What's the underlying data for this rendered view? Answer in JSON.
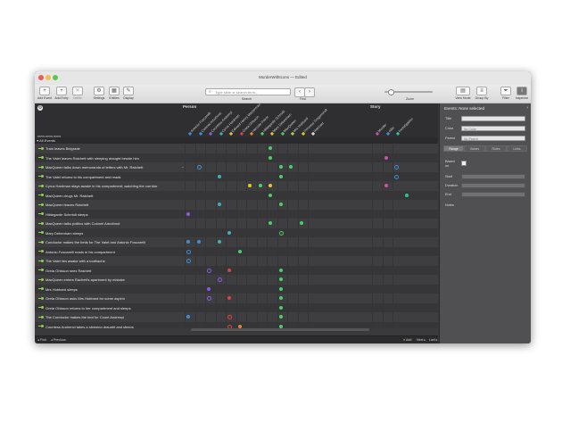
{
  "window": {
    "title": "MurderWithIcons — Edited",
    "traffic": [
      "#ee5c56",
      "#f5bd4f",
      "#5fc454"
    ]
  },
  "toolbar": {
    "add_event": "Add Event",
    "add_entry": "Add Entry",
    "delete": "Delete",
    "settings": "Settings",
    "entities": "Entities",
    "display": "Display",
    "search_placeholder": "Type slide or search term...",
    "search_label": "Search",
    "find_label": "Find",
    "zoom_label": "Zoom",
    "view_mode": "View Mode",
    "group_by": "Group By",
    "filter": "Filter",
    "inspector": "Inspector"
  },
  "columns": {
    "person_header": "Person",
    "story_header": "Story",
    "persons": [
      {
        "name": "Antonio Foscarelli",
        "color": "#3a8fd9"
      },
      {
        "name": "Colonel Arbuthnot",
        "color": "#3a8fd9"
      },
      {
        "name": "Countess Andrenyi",
        "color": "#8e5be0"
      },
      {
        "name": "Cyrus Hardman",
        "color": "#3fb0b7"
      },
      {
        "name": "Edward Henry Masterman",
        "color": "#e8c22e"
      },
      {
        "name": "Greta Ohlsson",
        "color": "#e04040"
      },
      {
        "name": "Hercule Poirot",
        "color": "#e8803a"
      },
      {
        "name": "Hildegarde Schmidt",
        "color": "#4ad068"
      },
      {
        "name": "Mary Debenham",
        "color": "#e8c22e"
      },
      {
        "name": "MacQueen",
        "color": "#4ad068"
      },
      {
        "name": "Mrs Hubbard",
        "color": "#a8d048"
      },
      {
        "name": "Princess Dragomiroff",
        "color": "#e8c22e"
      },
      {
        "name": "Ratchett",
        "color": "#d9d9d9"
      }
    ],
    "stories": [
      {
        "name": "Murder",
        "color": "#c94fb0"
      },
      {
        "name": "Alibi",
        "color": "#3a8fd9"
      },
      {
        "name": "Investigation",
        "color": "#2fc0a0"
      }
    ]
  },
  "section": "All Events",
  "events": [
    {
      "label": "Train leaves Belgrade",
      "dots": [
        {
          "c": 8,
          "color": "#4ad068",
          "h": false
        }
      ]
    },
    {
      "label": "The Valet leaves Ratchett with sleeping draught beside him",
      "dots": [
        {
          "c": 8,
          "color": "#4ad068",
          "h": false
        },
        {
          "c": 14,
          "color": "#c94fb0",
          "h": false
        }
      ]
    },
    {
      "label": "MacQueen talks down memoranda of letters with Mr. Ratchett",
      "dots": [
        {
          "c": 1,
          "color": "#3a8fd9",
          "h": true
        },
        {
          "c": 9,
          "color": "#4ad068",
          "h": false
        },
        {
          "c": 10,
          "color": "#4ad068",
          "h": false
        },
        {
          "c": 15,
          "color": "#3a8fd9",
          "h": true
        }
      ],
      "chev": true
    },
    {
      "label": "The Valet returns to his compartment and reads",
      "dots": [
        {
          "c": 3,
          "color": "#3fb0b7",
          "h": false
        },
        {
          "c": 9,
          "color": "#4ad068",
          "h": false
        },
        {
          "c": 15,
          "color": "#3a8fd9",
          "h": true
        }
      ]
    },
    {
      "label": "Cyrus Hardman stays awake in his compartment, watching the corridor",
      "dots": [
        {
          "c": 6,
          "color": "#e8c22e",
          "h": false
        },
        {
          "c": 7,
          "color": "#4ad068",
          "h": false
        },
        {
          "c": 8,
          "color": "#e8c22e",
          "h": false
        },
        {
          "c": 14,
          "color": "#c94fb0",
          "h": false
        }
      ]
    },
    {
      "label": "MacQueen drugs Mr. Ratchett",
      "dots": [
        {
          "c": 8,
          "color": "#4ad068",
          "h": false
        },
        {
          "c": 16,
          "color": "#2fc0a0",
          "h": false
        }
      ]
    },
    {
      "label": "MacQueen leaves Ratchett",
      "dots": [
        {
          "c": 3,
          "color": "#3fb0b7",
          "h": false
        },
        {
          "c": 9,
          "color": "#4ad068",
          "h": false
        }
      ]
    },
    {
      "label": "Hildegarde Schmidt sleeps",
      "dots": [
        {
          "c": 0,
          "color": "#8e5be0",
          "h": false
        }
      ]
    },
    {
      "label": "MacQueen talks politics with Colonel Arbuthnot",
      "dots": [
        {
          "c": 8,
          "color": "#4ad068",
          "h": false
        },
        {
          "c": 11,
          "color": "#4ad068",
          "h": false
        }
      ]
    },
    {
      "label": "Mary Debenham sleeps",
      "dots": [
        {
          "c": 4,
          "color": "#3fb0b7",
          "h": false
        },
        {
          "c": 9,
          "color": "#4ad068",
          "h": true
        }
      ]
    },
    {
      "label": "Conductor makes the beds for The Valet and Antonio Foscarelli",
      "dots": [
        {
          "c": 0,
          "color": "#3a8fd9",
          "h": false
        },
        {
          "c": 1,
          "color": "#3a8fd9",
          "h": false
        },
        {
          "c": 3,
          "color": "#3fb0b7",
          "h": false
        }
      ]
    },
    {
      "label": "Antonio Foscarelli reads in his compartment",
      "dots": [
        {
          "c": 0,
          "color": "#3a8fd9",
          "h": true
        },
        {
          "c": 5,
          "color": "#4ad068",
          "h": false
        }
      ]
    },
    {
      "label": "The Valet lies awake with a toothache",
      "dots": [
        {
          "c": 0,
          "color": "#3a8fd9",
          "h": true
        }
      ]
    },
    {
      "label": "Greta Ohlsson sees Ratchett",
      "dots": [
        {
          "c": 2,
          "color": "#8e5be0",
          "h": true
        },
        {
          "c": 4,
          "color": "#e04040",
          "h": false
        },
        {
          "c": 9,
          "color": "#4ad068",
          "h": false
        }
      ]
    },
    {
      "label": "MacQueen enters Rachett's apartment by mistake",
      "dots": [
        {
          "c": 3,
          "color": "#8e5be0",
          "h": true
        },
        {
          "c": 9,
          "color": "#4ad068",
          "h": false
        }
      ]
    },
    {
      "label": "Mrs Hubbard sleeps",
      "dots": [
        {
          "c": 2,
          "color": "#8e5be0",
          "h": false
        },
        {
          "c": 9,
          "color": "#4ad068",
          "h": false
        }
      ]
    },
    {
      "label": "Greta Ohlsson asks Mrs Hubbard for some aspirin",
      "dots": [
        {
          "c": 2,
          "color": "#8e5be0",
          "h": true
        },
        {
          "c": 4,
          "color": "#e04040",
          "h": false
        },
        {
          "c": 9,
          "color": "#4ad068",
          "h": false
        }
      ]
    },
    {
      "label": "Greta Ohlsson returns to her compartment and sleeps",
      "dots": [
        {
          "c": 9,
          "color": "#4ad068",
          "h": false
        }
      ]
    },
    {
      "label": "The Conductor makes the bed for Count Andrenyi",
      "dots": [
        {
          "c": 0,
          "color": "#3a8fd9",
          "h": false
        },
        {
          "c": 4,
          "color": "#e04040",
          "h": true
        },
        {
          "c": 9,
          "color": "#4ad068",
          "h": false
        }
      ]
    },
    {
      "label": "Countess Andrenyi takes a sleeping draught and sleeps",
      "dots": [
        {
          "c": 4,
          "color": "#e04040",
          "h": true
        },
        {
          "c": 5,
          "color": "#e8803a",
          "h": false
        },
        {
          "c": 9,
          "color": "#4ad068",
          "h": false
        }
      ]
    },
    {
      "label": "Count Andrenyi sleeps",
      "dots": [
        {
          "c": 4,
          "color": "#e04040",
          "h": true
        },
        {
          "c": 9,
          "color": "#4ad068",
          "h": false
        }
      ]
    },
    {
      "label": "MacQueen and Colonel Arbuthnot step out onto the platform at Vincovci",
      "dots": [
        {
          "c": 4,
          "color": "#e04040",
          "h": false
        },
        {
          "c": 9,
          "color": "#4ad068",
          "h": false
        }
      ]
    }
  ],
  "statusbar": {
    "left_find": "Find",
    "left_prev": "Previous",
    "add": "Add",
    "next": "Next",
    "last": "Last"
  },
  "inspector": {
    "title": "Events: None selected",
    "title_label": "Title",
    "color_label": "Color",
    "color_value": "No Color",
    "parent_label": "Parent",
    "parent_value": "No Parent",
    "tabs": [
      "Range",
      "Values",
      "Rules",
      "Links"
    ],
    "based_on_label": "Based on",
    "start_label": "Start",
    "duration_label": "Duration",
    "end_label": "End",
    "notes_label": "Notes"
  }
}
